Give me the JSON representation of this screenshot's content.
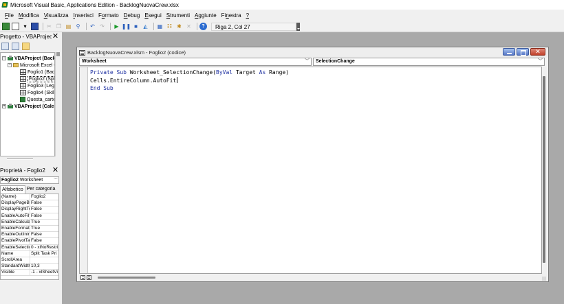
{
  "window": {
    "title": "Microsoft Visual Basic, Applications Edition - BacklogNuovaCrew.xlsx"
  },
  "menu": [
    {
      "label": "File",
      "key": "F",
      "rest": "ile"
    },
    {
      "label": "Modifica",
      "key": "M",
      "rest": "odifica"
    },
    {
      "label": "Visualizza",
      "key": "V",
      "rest": "isualizza"
    },
    {
      "label": "Inserisci",
      "key": "I",
      "rest": "nserisci"
    },
    {
      "label": "Formato",
      "key": "o",
      "pre": "F",
      "rest": "rmato"
    },
    {
      "label": "Debug",
      "key": "D",
      "rest": "ebug"
    },
    {
      "label": "Esegui",
      "key": "E",
      "rest": "segui"
    },
    {
      "label": "Strumenti",
      "key": "S",
      "rest": "trumenti"
    },
    {
      "label": "Aggiunte",
      "key": "A",
      "rest": "ggiunte"
    },
    {
      "label": "Finestra",
      "key": "n",
      "pre": "Fi",
      "rest": "estra"
    },
    {
      "label": "?",
      "key": "?",
      "rest": ""
    }
  ],
  "toolbar": {
    "status": "Riga 2, Col 27"
  },
  "project": {
    "title": "Progetto - VBAProject",
    "tree": [
      {
        "text": "VBAProject (Backlo",
        "level": 0,
        "kind": "proj",
        "expander": "−",
        "bold": true
      },
      {
        "text": "Microsoft Excel Og",
        "level": 1,
        "kind": "folder",
        "expander": "−",
        "bold": false
      },
      {
        "text": "Foglio1 (Backl",
        "level": 2,
        "kind": "sheet",
        "bold": false
      },
      {
        "text": "Foglio2 (Split",
        "level": 2,
        "kind": "sheet",
        "bold": false,
        "selected": true
      },
      {
        "text": "Foglio3 (Leger",
        "level": 2,
        "kind": "sheet",
        "bold": false
      },
      {
        "text": "Foglio4 (Skill",
        "level": 2,
        "kind": "sheet",
        "bold": false
      },
      {
        "text": "Questa_cartel",
        "level": 2,
        "kind": "wb",
        "bold": false
      },
      {
        "text": "VBAProject (Calend",
        "level": 0,
        "kind": "proj",
        "expander": "+",
        "bold": true
      }
    ]
  },
  "properties": {
    "title": "Proprietà - Foglio2",
    "object_name": "Foglio2",
    "object_type": "Worksheet",
    "tabs": [
      "Alfabetico",
      "Per categoria"
    ],
    "rows": [
      {
        "name": "(Name)",
        "value": "Foglio2"
      },
      {
        "name": "DisplayPageBre",
        "value": "False"
      },
      {
        "name": "DisplayRightTo",
        "value": "False"
      },
      {
        "name": "EnableAutoFilte",
        "value": "False"
      },
      {
        "name": "EnableCalculati",
        "value": "True"
      },
      {
        "name": "EnableFormatC",
        "value": "True"
      },
      {
        "name": "EnableOutlining",
        "value": "False"
      },
      {
        "name": "EnablePivotTab",
        "value": "False"
      },
      {
        "name": "EnableSelection",
        "value": "0 - xlNoRestri"
      },
      {
        "name": "Name",
        "value": "Split Task Pri"
      },
      {
        "name": "ScrollArea",
        "value": ""
      },
      {
        "name": "StandardWidth",
        "value": "10,3"
      },
      {
        "name": "Visible",
        "value": "-1 - xlSheetVi"
      }
    ]
  },
  "code_window": {
    "title": "BacklogNuovaCrew.xlsm - Foglio2 (codice)",
    "object_combo": "Worksheet",
    "procedure_combo": "SelectionChange",
    "lines": [
      [
        {
          "t": "Private Sub",
          "kw": true
        },
        {
          "t": " Worksheet_SelectionChange(",
          "kw": false
        },
        {
          "t": "ByVal",
          "kw": true
        },
        {
          "t": " Target ",
          "kw": false
        },
        {
          "t": "As",
          "kw": true
        },
        {
          "t": " Range)",
          "kw": false
        }
      ],
      [
        {
          "t": "Cells.EntireColumn.AutoFit",
          "kw": false
        }
      ],
      [
        {
          "t": "End Sub",
          "kw": true
        }
      ]
    ]
  },
  "colors": {
    "keyword": "#1c2ea0",
    "workspace": "#a9a9a9"
  }
}
